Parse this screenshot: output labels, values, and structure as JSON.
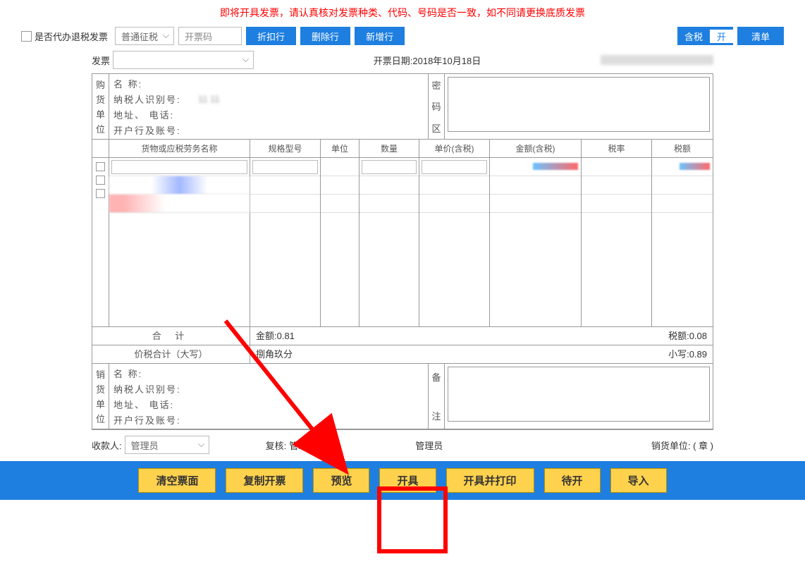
{
  "warning_text": "即将开具发票，请认真核对发票种类、代码、号码是否一致，如不同请更换底质发票",
  "toolbar": {
    "refund_checkbox_label": "是否代办退税发票",
    "tax_type_select": "普通征税",
    "kpm_placeholder": "开票码",
    "discount_btn": "折扣行",
    "delete_btn": "删除行",
    "newrow_btn": "新增行",
    "tax_toggle_left": "含税",
    "tax_toggle_right": "开",
    "list_btn": "清单"
  },
  "meta": {
    "fp_label": "发票",
    "date_label": "开票日期:",
    "date_value": "2018年10月18日"
  },
  "buyer": {
    "side": [
      "购",
      "货",
      "单",
      "位"
    ],
    "name_label": "名        称:",
    "taxid_label": "纳税人识别号:",
    "taxid_value": "11                                   11",
    "addr_label": "地址、  电话:",
    "bank_label": "开户行及账号:"
  },
  "password_side": [
    "密",
    "码",
    "区"
  ],
  "columns": {
    "name": "货物或应税劳务名称",
    "model": "规格型号",
    "unit": "单位",
    "qty": "数量",
    "price": "单价(含税)",
    "amount": "金额(含税)",
    "rate": "税率",
    "tax": "税额"
  },
  "totals": {
    "sum_label": "合    计",
    "amount_text": "金额:0.81",
    "tax_text": "税额:0.08",
    "upper_label": "价税合计（大写）",
    "upper_value": "捌角玖分",
    "lower_label": "小写:0.89"
  },
  "seller": {
    "side": [
      "销",
      "货",
      "单",
      "位"
    ],
    "name_label": "名        称:",
    "taxid_label": "纳税人识别号:",
    "addr_label": "地址、  电话:",
    "bank_label": "开户行及账号:"
  },
  "remark_side": [
    "备",
    "",
    "注"
  ],
  "signers": {
    "payee_label": "收款人:",
    "payee_value": "管理员",
    "checker_label": "复核:",
    "checker_value": "管理员",
    "issuer_suffix": "管理员",
    "seller_unit_label": "销货单位:  ( 章 )"
  },
  "footer": {
    "clear": "清空票面",
    "copy": "复制开票",
    "preview": "预览",
    "issue": "开具",
    "issue_print": "开具并打印",
    "pending": "待开",
    "import": "导入"
  }
}
